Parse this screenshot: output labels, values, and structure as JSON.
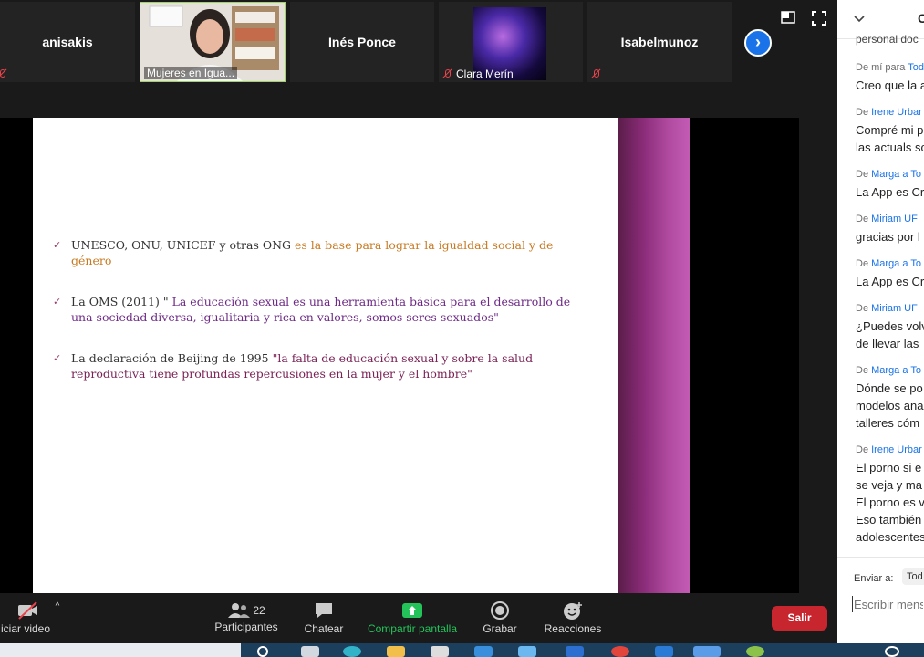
{
  "gallery": {
    "participants": [
      {
        "name": "anisakis"
      },
      {
        "label": "Mujeres en Igua..."
      },
      {
        "name": "Inés Ponce"
      },
      {
        "label": "Clara Merín"
      },
      {
        "name": "Isabelmunoz"
      }
    ]
  },
  "slide": {
    "bullets": [
      {
        "plain": "UNESCO,  ONU, UNICEF y otras ONG ",
        "highlight": " es la base para lograr la igualdad social y de género"
      },
      {
        "plain": "La OMS (2011) \" ",
        "highlight": "La educación sexual es una herramienta básica para el desarrollo de una sociedad diversa, igualitaria y rica en valores, somos seres sexuados\""
      },
      {
        "plain": "La declaración de Beijing de 1995  ",
        "highlight": "\"la falta de educación sexual y sobre la salud reproductiva tiene profundas repercusiones en la mujer y el hombre\""
      }
    ]
  },
  "toolbar": {
    "video_label": "iciar video",
    "participants_label": "Participantes",
    "participants_count": "22",
    "chat_label": "Chatear",
    "share_label": "Compartir pantalla",
    "record_label": "Grabar",
    "reactions_label": "Reacciones",
    "leave_label": "Salir"
  },
  "chat": {
    "header": "C",
    "messages": [
      {
        "text": [
          "personal doc"
        ]
      },
      {
        "from": "De mí para",
        "to": "Tod",
        "text": [
          "Creo que la a"
        ]
      },
      {
        "from": "De",
        "name": "Irene Urbar",
        "text": [
          "Compré mi p",
          "las actuals so"
        ]
      },
      {
        "from": "De",
        "name": "Marga",
        "to": "a To",
        "text": [
          "La App es Cr"
        ]
      },
      {
        "from": "De",
        "name": "Miriam UF",
        "text": [
          "gracias por l"
        ]
      },
      {
        "from": "De",
        "name": "Marga",
        "to": "a To",
        "text": [
          "La App es Cr"
        ]
      },
      {
        "from": "De",
        "name": "Miriam UF",
        "text": [
          "¿Puedes volv",
          "de llevar las"
        ]
      },
      {
        "from": "De",
        "name": "Marga",
        "to": "a To",
        "text": [
          "Dónde se po",
          "modelos ana",
          "talleres cóm"
        ]
      },
      {
        "from": "De",
        "name": "Irene Urbar",
        "text": [
          "El porno si e",
          "se veja y ma",
          "El porno es v",
          "Eso también",
          "adolescentes"
        ]
      }
    ],
    "send_to_label": "Enviar a:",
    "send_to_value": "Tod",
    "input_placeholder": "Escribir mens"
  },
  "colors": {
    "accent": "#1a73e8",
    "leave": "#c7262e",
    "share_green": "#23c35a",
    "slide_purple": "#8a2c78"
  }
}
